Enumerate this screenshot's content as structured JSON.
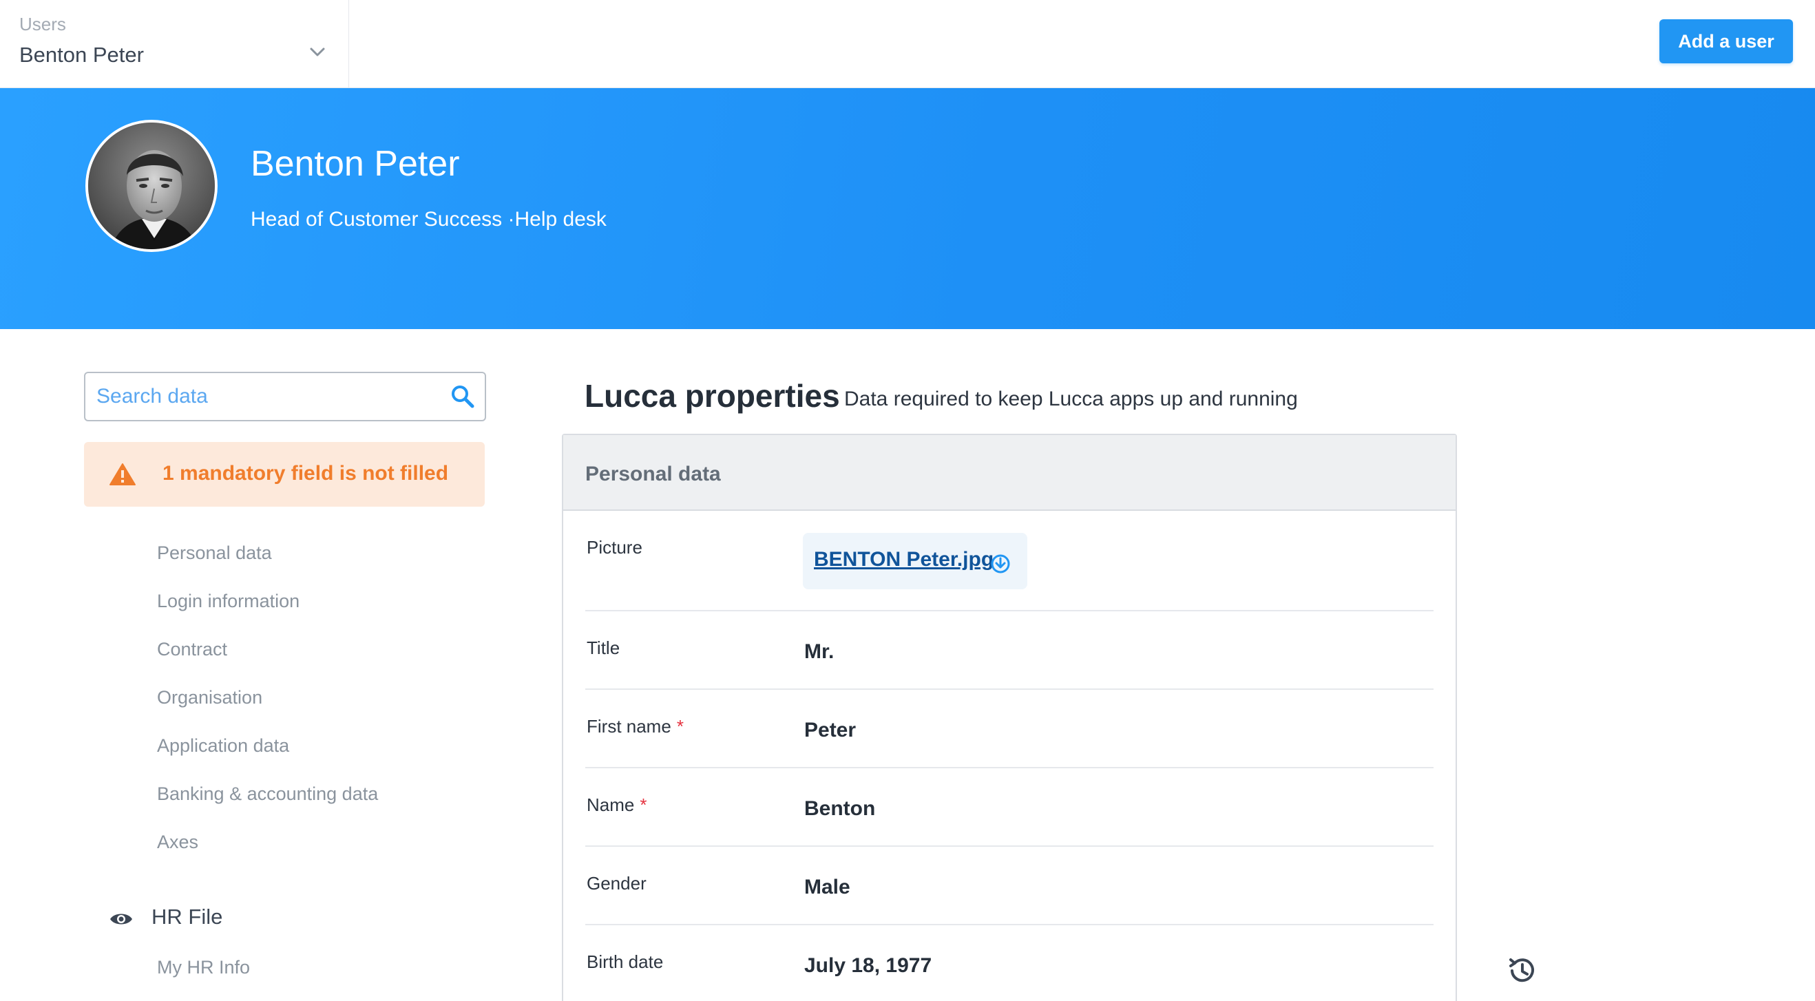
{
  "topbar": {
    "user_select_label": "Users",
    "user_select_value": "Benton Peter",
    "add_user_label": "Add a user"
  },
  "header": {
    "name": "Benton Peter",
    "subtitle": "Head of Customer Success ·Help desk"
  },
  "sidebar": {
    "search_placeholder": "Search data",
    "alert_text": "1 mandatory field is not filled",
    "items": [
      {
        "label": "Personal data"
      },
      {
        "label": "Login information"
      },
      {
        "label": "Contract"
      },
      {
        "label": "Organisation"
      },
      {
        "label": "Application data"
      },
      {
        "label": "Banking & accounting data"
      },
      {
        "label": "Axes"
      }
    ],
    "hr_file_label": "HR File",
    "hr_sub_items": [
      {
        "label": "My HR Info"
      }
    ]
  },
  "main": {
    "title": "Lucca properties",
    "description": "Data required to keep Lucca apps up and running",
    "card_title": "Personal data",
    "fields": {
      "picture": {
        "label": "Picture",
        "file_name": "BENTON Peter.jpg"
      },
      "title": {
        "label": "Title",
        "value": "Mr."
      },
      "first_name": {
        "label": "First name",
        "value": "Peter",
        "required_mark": "*"
      },
      "name": {
        "label": "Name",
        "value": "Benton",
        "required_mark": "*"
      },
      "gender": {
        "label": "Gender",
        "value": "Male"
      },
      "birth_date": {
        "label": "Birth date",
        "value": "July 18, 1977"
      }
    }
  },
  "colors": {
    "primary": "#2196f3",
    "header_band": "#1e90f6",
    "warning_text": "#f07d2c",
    "warning_bg": "#fde9db",
    "required": "#e5323f",
    "link": "#10549a"
  },
  "icons": {
    "user_select": "chevron-down-icon",
    "search": "search-icon",
    "alert": "warning-icon",
    "hr_file": "eye-icon",
    "file": "download-icon",
    "history": "history-icon"
  }
}
